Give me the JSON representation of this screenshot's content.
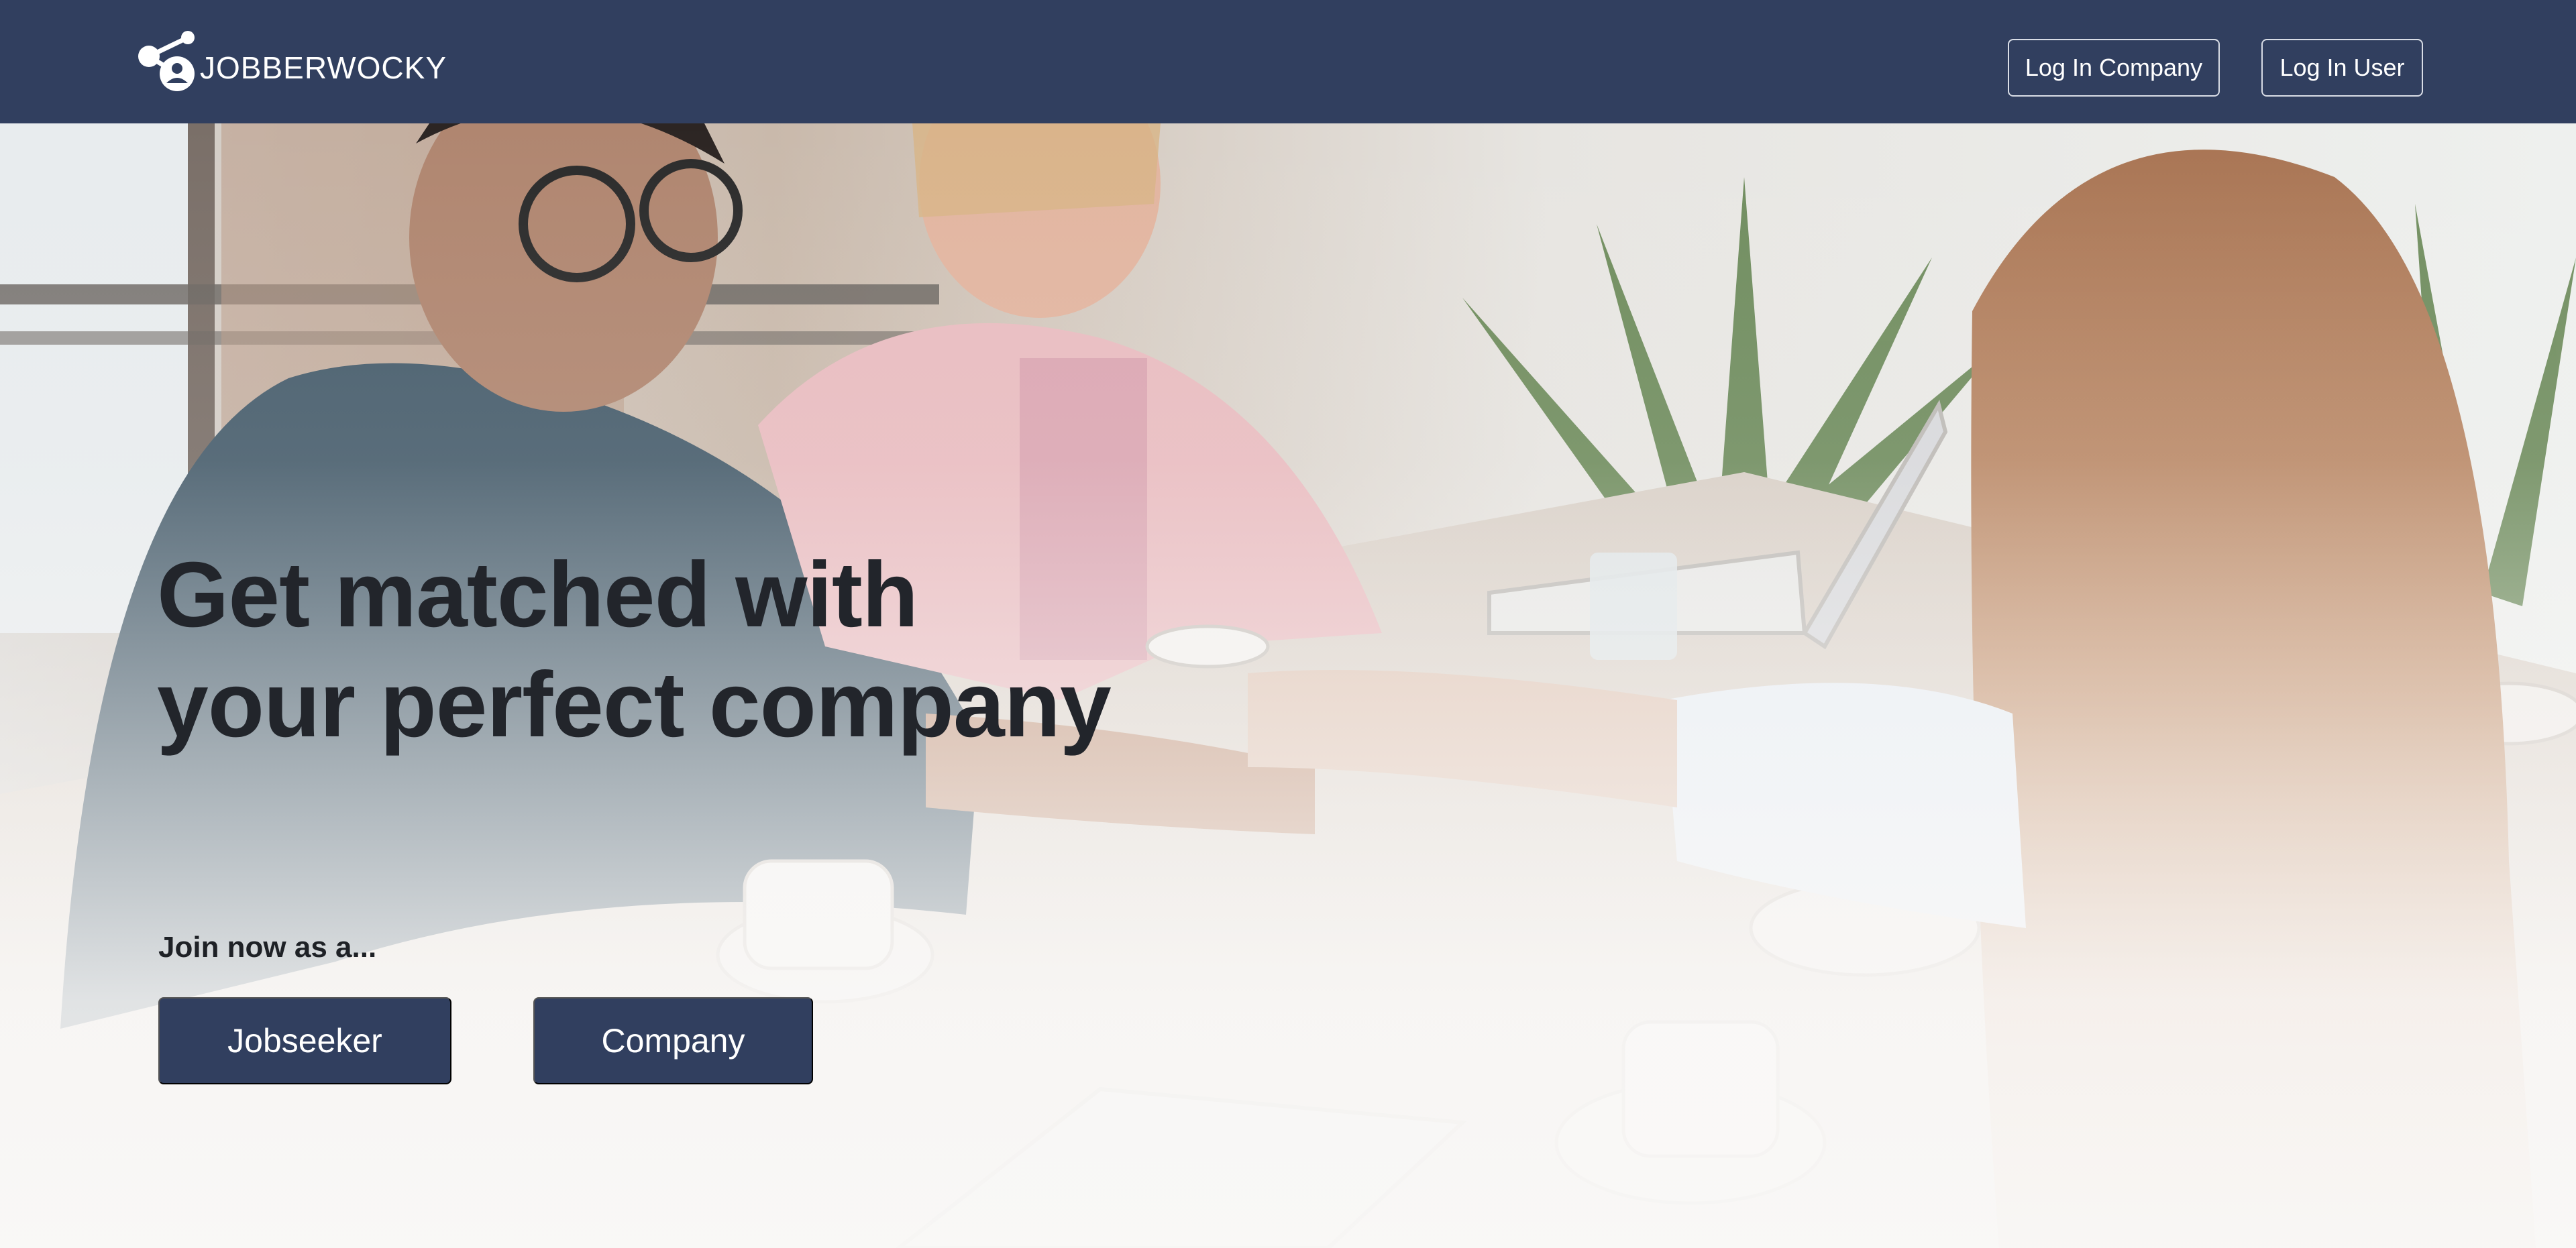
{
  "header": {
    "brand": "JOBBERWOCKY",
    "logo_icon": "network-person-icon",
    "login_company_label": "Log In Company",
    "login_user_label": "Log In User"
  },
  "hero": {
    "headline_line1": "Get matched with",
    "headline_line2": "your perfect company",
    "join_text": "Join now as a...",
    "jobseeker_label": "Jobseeker",
    "company_label": "Company",
    "background_image": "office-handshake-photo"
  },
  "colors": {
    "navbar": "#313f5f",
    "button": "#313f5f",
    "headline": "#22252b"
  }
}
